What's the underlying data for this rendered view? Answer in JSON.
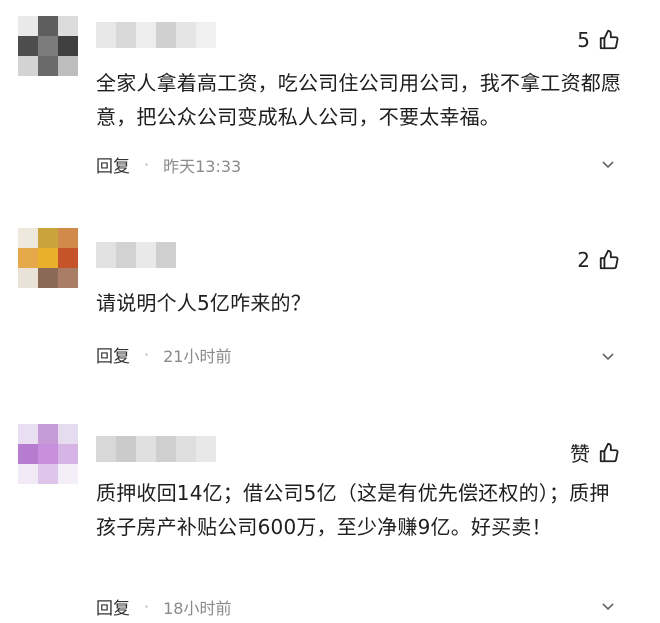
{
  "comments": [
    {
      "likes": "5",
      "text": "全家人拿着高工资，吃公司住公司用公司，我不拿工资都愿意，把公众公司变成私人公司，不要太幸福。",
      "reply": "回复",
      "sep": "·",
      "time": "昨天13:33",
      "icons": [
        "thumbs-up-icon",
        "chevron-down-icon"
      ]
    },
    {
      "likes": "2",
      "text": "请说明个人5亿咋来的？",
      "reply": "回复",
      "sep": "·",
      "time": "21小时前",
      "icons": [
        "thumbs-up-icon",
        "chevron-down-icon"
      ]
    },
    {
      "likes": "赞",
      "text": "质押收回14亿；借公司5亿（这是有优先偿还权的）；质押孩子房产补贴公司600万，至少净赚9亿。好买卖！",
      "reply": "回复",
      "sep": "·",
      "time": "18小时前",
      "icons": [
        "thumbs-up-icon",
        "chevron-down-icon"
      ]
    }
  ],
  "colors": {
    "text": "#1e1e1e",
    "meta": "#8a8a8a"
  }
}
